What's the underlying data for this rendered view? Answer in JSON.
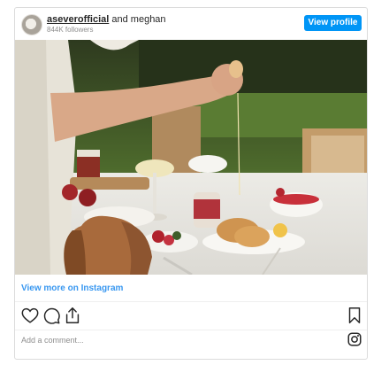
{
  "header": {
    "user_handle": "aseverofficial",
    "collab_text": " and meghan",
    "followers": "844K followers",
    "view_profile_label": "View profile"
  },
  "photo": {
    "alt": "Breakfast table outdoors with a dog peeking at the food"
  },
  "footer": {
    "view_more_label": "View more on Instagram",
    "comment_placeholder": "Add a comment..."
  },
  "icons": {
    "like": "heart-icon",
    "comment": "comment-icon",
    "share": "share-icon",
    "save": "bookmark-icon",
    "instagram": "instagram-icon"
  },
  "colors": {
    "accent": "#0095f6",
    "link": "#3897f0"
  }
}
